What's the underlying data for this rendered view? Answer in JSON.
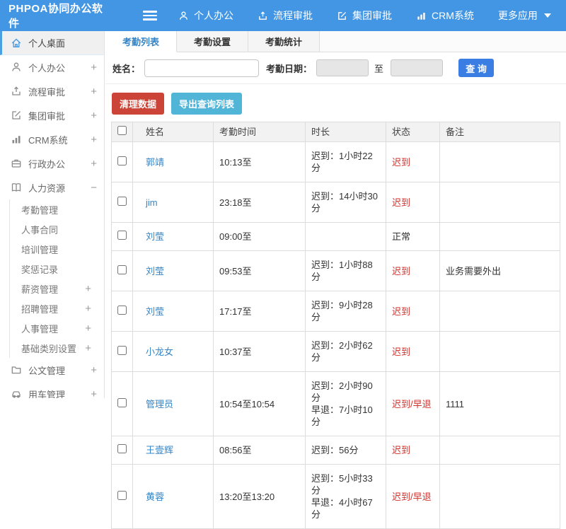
{
  "colors": {
    "header_blue": "#4396e3",
    "search_button_blue": "#3b7ee3",
    "clean_button_red": "#cb4437",
    "export_button_cyan": "#51b5d8",
    "link_blue": "#3585c6",
    "status_red": "#d2322d"
  },
  "header": {
    "logo": "PHPOA协同办公软件",
    "nav": [
      {
        "label": "个人办公",
        "icon": "user-icon"
      },
      {
        "label": "流程审批",
        "icon": "workflow-icon"
      },
      {
        "label": "集团审批",
        "icon": "edit-icon"
      },
      {
        "label": "CRM系统",
        "icon": "bar-chart-icon"
      },
      {
        "label": "更多应用",
        "icon": "caret-down-icon"
      }
    ]
  },
  "sidebar": {
    "items": [
      {
        "label": "个人桌面",
        "icon": "home-icon",
        "expand": "",
        "active": true
      },
      {
        "label": "个人办公",
        "icon": "user-icon",
        "expand": "+"
      },
      {
        "label": "流程审批",
        "icon": "workflow-icon",
        "expand": "+"
      },
      {
        "label": "集团审批",
        "icon": "edit-icon",
        "expand": "+"
      },
      {
        "label": "CRM系统",
        "icon": "bar-chart-icon",
        "expand": "+"
      },
      {
        "label": "行政办公",
        "icon": "briefcase-icon",
        "expand": "+"
      },
      {
        "label": "人力资源",
        "icon": "book-icon",
        "expand": "−"
      },
      {
        "label": "考勤管理",
        "expand": ""
      },
      {
        "label": "人事合同",
        "expand": ""
      },
      {
        "label": "培训管理",
        "expand": ""
      },
      {
        "label": "奖惩记录",
        "expand": ""
      },
      {
        "label": "薪资管理",
        "expand": "+"
      },
      {
        "label": "招聘管理",
        "expand": "+"
      },
      {
        "label": "人事管理",
        "expand": "+"
      },
      {
        "label": "基础类别设置",
        "expand": "+"
      },
      {
        "label": "公文管理",
        "icon": "folder-icon",
        "expand": "+"
      },
      {
        "label": "用车管理",
        "icon": "car-icon",
        "expand": "+"
      }
    ]
  },
  "tabs": [
    {
      "label": "考勤列表",
      "active": true
    },
    {
      "label": "考勤设置",
      "active": false
    },
    {
      "label": "考勤统计",
      "active": false
    }
  ],
  "search": {
    "name_label": "姓名：",
    "name_value": "",
    "date_label": "考勤日期：",
    "date_from": "",
    "to_label": "至",
    "date_to": "",
    "search_button": "查 询"
  },
  "actions": {
    "clean_button": "清理数据",
    "export_button": "导出查询列表"
  },
  "table": {
    "columns": [
      "姓名",
      "考勤时间",
      "时长",
      "状态",
      "备注"
    ],
    "rows": [
      {
        "name": "郭靖",
        "time": "10:13至",
        "duration1": "迟到：1小时22分",
        "duration2": "",
        "status": "迟到",
        "remark": ""
      },
      {
        "name": "jim",
        "time": "23:18至",
        "duration1": "迟到：14小时30分",
        "duration2": "",
        "status": "迟到",
        "remark": ""
      },
      {
        "name": "刘莹",
        "time": "09:00至",
        "duration1": "",
        "duration2": "",
        "status": "正常",
        "remark": ""
      },
      {
        "name": "刘莹",
        "time": "09:53至",
        "duration1": "迟到：1小时88分",
        "duration2": "",
        "status": "迟到",
        "remark": "业务需要外出"
      },
      {
        "name": "刘莹",
        "time": "17:17至",
        "duration1": "迟到：9小时28分",
        "duration2": "",
        "status": "迟到",
        "remark": ""
      },
      {
        "name": "小龙女",
        "time": "10:37至",
        "duration1": "迟到：2小时62分",
        "duration2": "",
        "status": "迟到",
        "remark": ""
      },
      {
        "name": "管理员",
        "time": "10:54至10:54",
        "duration1": "迟到：2小时90分",
        "duration2": "早退：7小时10分",
        "status": "迟到/早退",
        "remark": "1111"
      },
      {
        "name": "王壹辉",
        "time": "08:56至",
        "duration1": "迟到：56分",
        "duration2": "",
        "status": "迟到",
        "remark": ""
      },
      {
        "name": "黄蓉",
        "time": "13:20至13:20",
        "duration1": "迟到：5小时33分",
        "duration2": "早退：4小时67分",
        "status": "迟到/早退",
        "remark": ""
      }
    ]
  }
}
